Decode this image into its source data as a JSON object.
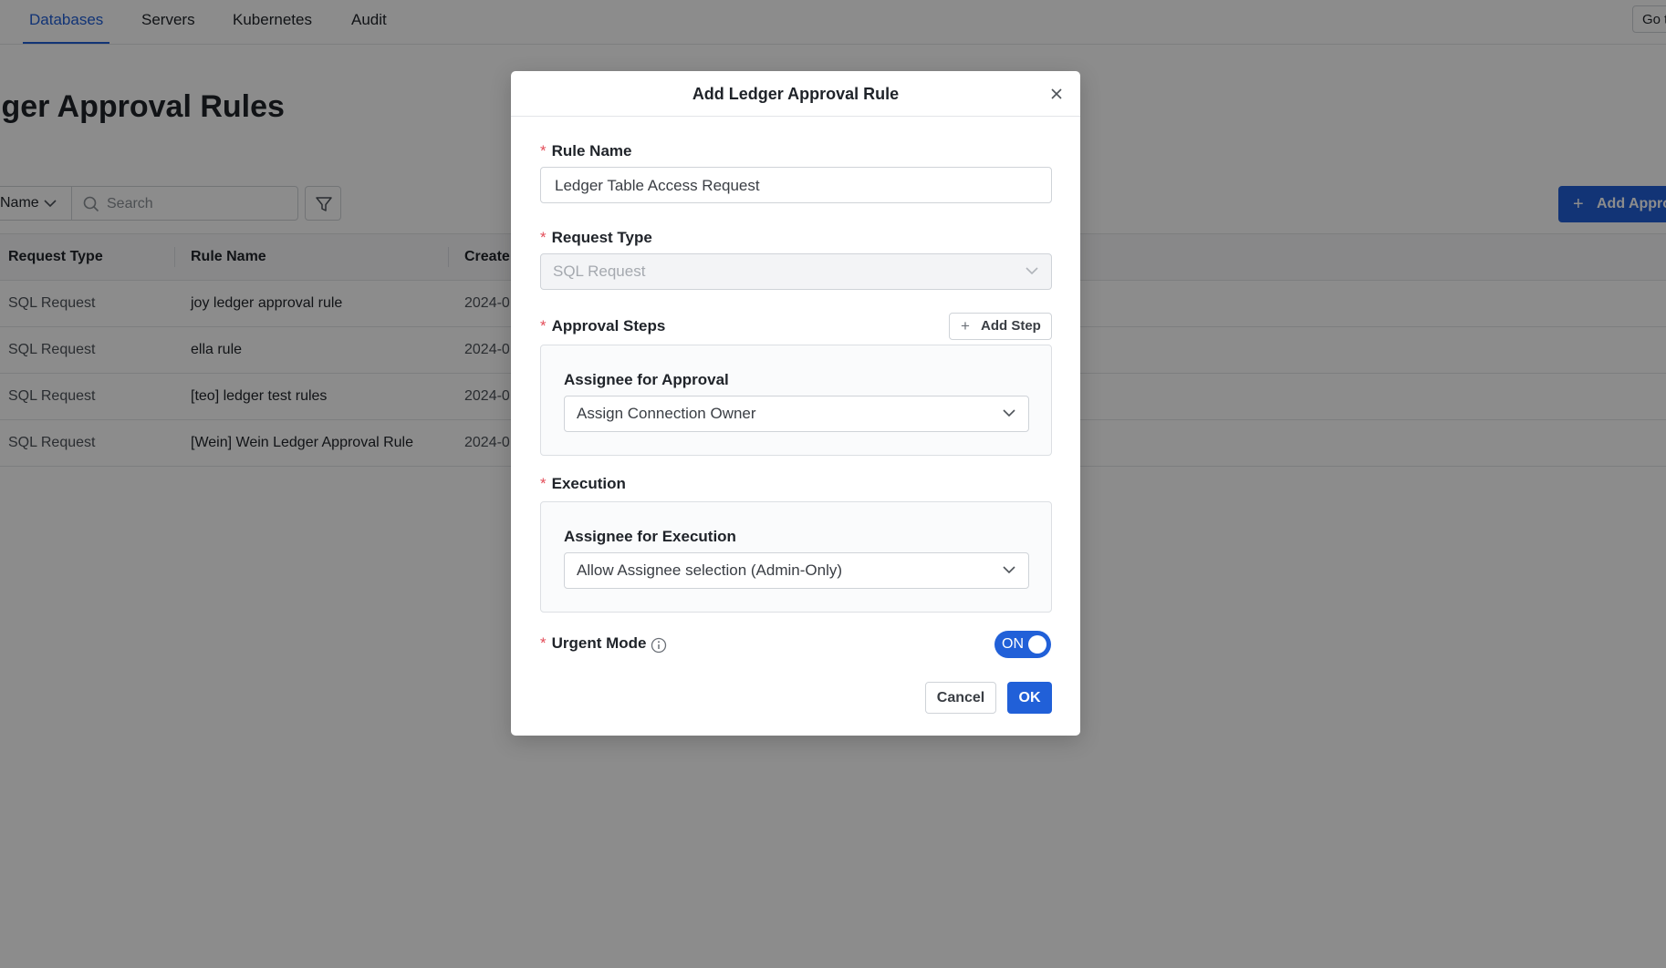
{
  "nav": {
    "tabs": [
      {
        "label": "Databases",
        "active": true
      },
      {
        "label": "Servers",
        "active": false
      },
      {
        "label": "Kubernetes",
        "active": false
      },
      {
        "label": "Audit",
        "active": false
      }
    ],
    "goto_label": "Go t"
  },
  "page": {
    "title": "lger Approval Rules",
    "filter_select": "Name",
    "search_placeholder": "Search",
    "add_button": "Add Appro"
  },
  "table": {
    "columns": [
      "Request Type",
      "Rule Name",
      "Create"
    ],
    "rows": [
      {
        "request_type": "SQL Request",
        "rule_name": "joy ledger approval rule",
        "created": "2024-0"
      },
      {
        "request_type": "SQL Request",
        "rule_name": "ella rule",
        "created": "2024-0"
      },
      {
        "request_type": "SQL Request",
        "rule_name": "[teo] ledger test rules",
        "created": "2024-0"
      },
      {
        "request_type": "SQL Request",
        "rule_name": "[Wein] Wein Ledger Approval Rule",
        "created": "2024-0"
      }
    ]
  },
  "modal": {
    "title": "Add Ledger Approval Rule",
    "rule_name": {
      "label": "Rule Name",
      "value": "Ledger Table Access Request"
    },
    "request_type": {
      "label": "Request Type",
      "value": "SQL Request"
    },
    "approval_steps": {
      "label": "Approval Steps",
      "add_step": "Add Step",
      "assignee_label": "Assignee for Approval",
      "assignee_value": "Assign Connection Owner"
    },
    "execution": {
      "label": "Execution",
      "assignee_label": "Assignee for Execution",
      "assignee_value": "Allow Assignee selection (Admin-Only)"
    },
    "urgent_mode": {
      "label": "Urgent Mode",
      "toggle_text": "ON",
      "enabled": true
    },
    "cancel": "Cancel",
    "ok": "OK",
    "required_mark": "*"
  },
  "colors": {
    "accent": "#2160d8",
    "required": "#e34d59",
    "mask": "rgba(0,0,0,0.45)"
  }
}
